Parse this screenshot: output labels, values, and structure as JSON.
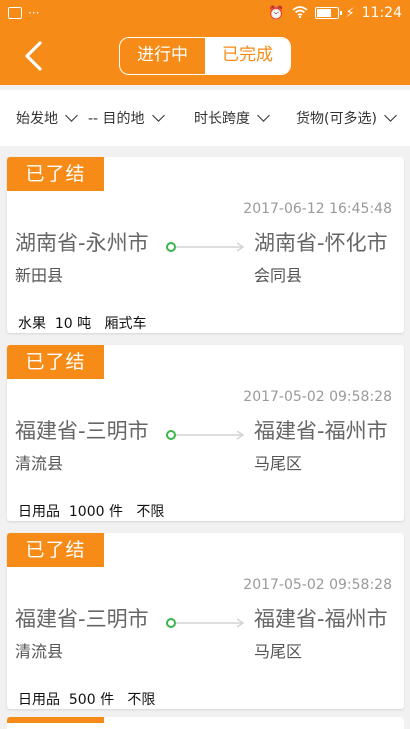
{
  "status_bar": {
    "left_dots": "···",
    "time": "11:24",
    "icons": [
      "image-icon",
      "alarm-icon",
      "wifi-icon",
      "battery-icon",
      "charging-icon"
    ]
  },
  "nav": {
    "tabs": [
      {
        "label": "进行中",
        "active": false
      },
      {
        "label": "已完成",
        "active": true
      }
    ],
    "back_icon": "chevron-left-icon"
  },
  "filters": [
    {
      "label": "始发地"
    },
    {
      "label": "-- 目的地"
    },
    {
      "label": "时长跨度"
    },
    {
      "label": "货物(可多选)"
    }
  ],
  "colors": {
    "accent": "#f68b17",
    "route_dot": "#3bb54a"
  },
  "orders": [
    {
      "status": "已了结",
      "time": "2017-06-12 16:45:48",
      "from_city": "湖南省-永州市",
      "from_district": "新田县",
      "to_city": "湖南省-怀化市",
      "to_district": "会同县",
      "cargo": "水果  10 吨   厢式车"
    },
    {
      "status": "已了结",
      "time": "2017-05-02 09:58:28",
      "from_city": "福建省-三明市",
      "from_district": "清流县",
      "to_city": "福建省-福州市",
      "to_district": "马尾区",
      "cargo": "日用品  1000 件   不限"
    },
    {
      "status": "已了结",
      "time": "2017-05-02 09:58:28",
      "from_city": "福建省-三明市",
      "from_district": "清流县",
      "to_city": "福建省-福州市",
      "to_district": "马尾区",
      "cargo": "日用品  500 件   不限"
    }
  ]
}
